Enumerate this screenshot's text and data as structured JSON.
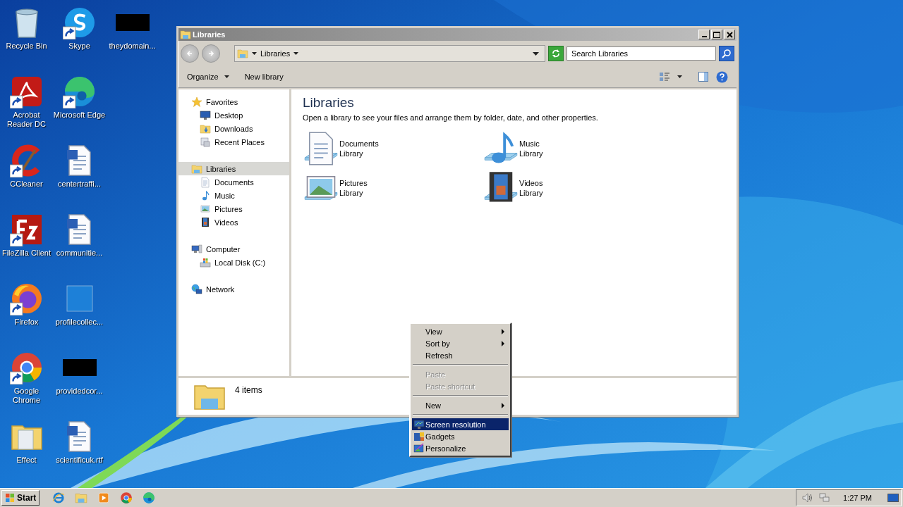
{
  "desktop_icons": [
    {
      "label": "Recycle Bin",
      "kind": "recycle-bin",
      "shortcut": false
    },
    {
      "label": "Acrobat Reader DC",
      "kind": "acrobat",
      "shortcut": true
    },
    {
      "label": "CCleaner",
      "kind": "ccleaner",
      "shortcut": true
    },
    {
      "label": "FileZilla Client",
      "kind": "filezilla",
      "shortcut": true
    },
    {
      "label": "Firefox",
      "kind": "firefox",
      "shortcut": true
    },
    {
      "label": "Google Chrome",
      "kind": "chrome",
      "shortcut": true
    },
    {
      "label": "Effect",
      "kind": "folder",
      "shortcut": false
    },
    {
      "label": "Skype",
      "kind": "skype",
      "shortcut": true
    },
    {
      "label": "Microsoft Edge",
      "kind": "edge",
      "shortcut": true
    },
    {
      "label": "centertraffi...",
      "kind": "word",
      "shortcut": false
    },
    {
      "label": "communitie...",
      "kind": "word",
      "shortcut": false
    },
    {
      "label": "profilecollec...",
      "kind": "blank",
      "shortcut": false
    },
    {
      "label": "providedcor...",
      "kind": "thumbnail",
      "shortcut": false
    },
    {
      "label": "scientificuk.rtf",
      "kind": "word",
      "shortcut": false
    },
    {
      "label": "theydomain...",
      "kind": "thumbnail",
      "shortcut": false
    }
  ],
  "explorer": {
    "title": "Libraries",
    "address": "Libraries",
    "search": {
      "placeholder": "Search Libraries"
    },
    "toolbar": [
      {
        "label": "Organize",
        "kind": "menu"
      },
      {
        "label": "New library",
        "kind": "button"
      }
    ],
    "nav": [
      {
        "label": "Favorites",
        "kind": "star",
        "selected": false,
        "children": [
          {
            "label": "Desktop",
            "kind": "desktop",
            "selected": false
          },
          {
            "label": "Downloads",
            "kind": "downloads",
            "selected": false
          },
          {
            "label": "Recent Places",
            "kind": "recent",
            "selected": false
          }
        ]
      },
      {
        "label": "Libraries",
        "kind": "libraries",
        "selected": true,
        "children": [
          {
            "label": "Documents",
            "kind": "documents",
            "selected": false
          },
          {
            "label": "Music",
            "kind": "music",
            "selected": false
          },
          {
            "label": "Pictures",
            "kind": "pictures",
            "selected": false
          },
          {
            "label": "Videos",
            "kind": "videos",
            "selected": false
          }
        ]
      },
      {
        "label": "Computer",
        "kind": "computer",
        "selected": false,
        "children": [
          {
            "label": "Local Disk (C:)",
            "kind": "disk",
            "selected": false
          }
        ]
      },
      {
        "label": "Network",
        "kind": "network",
        "selected": false
      }
    ],
    "heading": "Libraries",
    "description": "Open a library to see your files and arrange them by folder, date, and other properties.",
    "libraries": [
      {
        "name": "Documents",
        "type": "Library",
        "kind": "documents"
      },
      {
        "name": "Music",
        "type": "Library",
        "kind": "music"
      },
      {
        "name": "Pictures",
        "type": "Library",
        "kind": "pictures"
      },
      {
        "name": "Videos",
        "type": "Library",
        "kind": "videos"
      }
    ],
    "details": "4 items"
  },
  "context_menu": [
    [
      {
        "label": "View",
        "kind": "submenu",
        "disabled": false,
        "selected": false
      },
      {
        "label": "Sort by",
        "kind": "submenu",
        "disabled": false,
        "selected": false
      },
      {
        "label": "Refresh",
        "kind": "plain",
        "disabled": false,
        "selected": false
      }
    ],
    [
      {
        "label": "Paste",
        "kind": "plain",
        "disabled": true,
        "selected": false
      },
      {
        "label": "Paste shortcut",
        "kind": "plain",
        "disabled": true,
        "selected": false
      }
    ],
    [
      {
        "label": "New",
        "kind": "submenu",
        "disabled": false,
        "selected": false
      }
    ],
    [
      {
        "label": "Screen resolution",
        "kind": "display",
        "disabled": false,
        "selected": true
      },
      {
        "label": "Gadgets",
        "kind": "gadgets",
        "disabled": false,
        "selected": false
      },
      {
        "label": "Personalize",
        "kind": "personalize",
        "disabled": false,
        "selected": false
      }
    ]
  ],
  "taskbar": {
    "start": "Start",
    "apps": [
      {
        "kind": "ie"
      },
      {
        "kind": "explorer"
      },
      {
        "kind": "media"
      },
      {
        "kind": "chrome"
      },
      {
        "kind": "edge"
      }
    ],
    "clock": "1:27 PM"
  }
}
